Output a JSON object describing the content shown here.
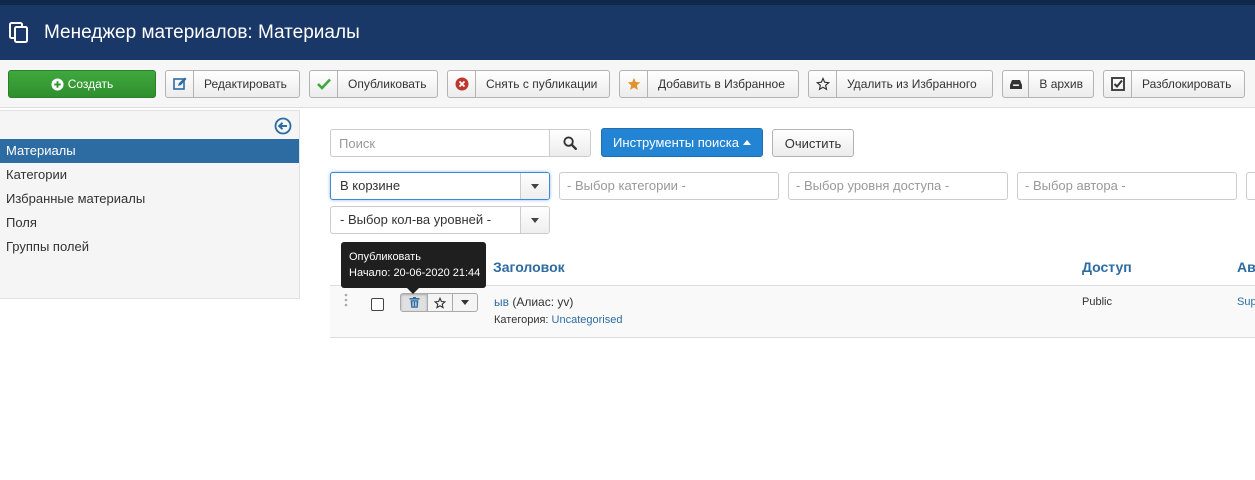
{
  "header": {
    "title": "Менеджер материалов: Материалы",
    "icon": "copy-icon"
  },
  "toolbar": {
    "buttons": [
      {
        "label": "Создать",
        "icon": "plus-circle-icon"
      },
      {
        "label": "Редактировать",
        "icon": "edit-icon"
      },
      {
        "label": "Опубликовать",
        "icon": "check-icon"
      },
      {
        "label": "Снять с публикации",
        "icon": "times-circle-icon"
      },
      {
        "label": "Добавить в Избранное",
        "icon": "star-filled-icon"
      },
      {
        "label": "Удалить из Избранного",
        "icon": "star-empty-icon"
      },
      {
        "label": "В архив",
        "icon": "archive-icon"
      },
      {
        "label": "Разблокировать",
        "icon": "checkbox-icon"
      }
    ]
  },
  "sidebar": {
    "items": [
      {
        "label": "Материалы",
        "active": true
      },
      {
        "label": "Категории"
      },
      {
        "label": "Избранные материалы"
      },
      {
        "label": "Поля"
      },
      {
        "label": "Группы полей"
      }
    ]
  },
  "search": {
    "placeholder": "Поиск",
    "tools_label": "Инструменты поиска",
    "clear_label": "Очистить"
  },
  "filters": {
    "status": "В корзине",
    "category": "- Выбор категории -",
    "access": "- Выбор уровня доступа -",
    "author": "- Выбор автора -",
    "levels": "- Выбор кол-ва уровней -"
  },
  "table": {
    "headers": {
      "title": "Заголовок",
      "access": "Доступ",
      "author": "Авт"
    },
    "rows": [
      {
        "title": "ыв",
        "alias": "(Алиас: yv)",
        "category_prefix": "Категория:",
        "category": "Uncategorised",
        "access": "Public",
        "author": "Sup"
      }
    ]
  },
  "tooltip": {
    "line1": "Опубликовать",
    "line2": "Начало: 20-06-2020 21:44"
  },
  "colors": {
    "header_bg": "#1a3867",
    "accent": "#2d6ca2",
    "create_green": "#3fa83e",
    "tools_blue": "#2384d3"
  }
}
